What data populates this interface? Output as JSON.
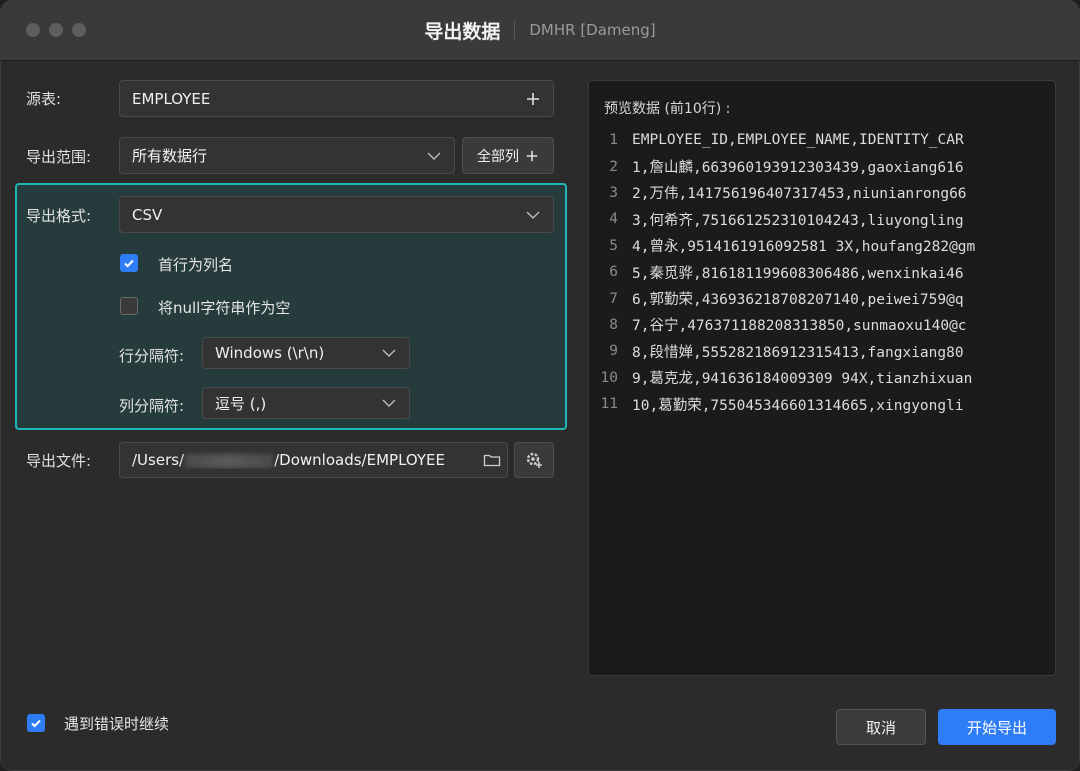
{
  "window": {
    "title": "导出数据",
    "subtitle": "DMHR  [Dameng]"
  },
  "form": {
    "source_label": "源表:",
    "source_value": "EMPLOYEE",
    "range_label": "导出范围:",
    "range_value": "所有数据行",
    "columns_button": "全部列",
    "format_label": "导出格式:",
    "format_value": "CSV",
    "header_row_label": "首行为列名",
    "header_row_checked": true,
    "null_empty_label": "将null字符串作为空",
    "null_empty_checked": false,
    "row_sep_label": "行分隔符:",
    "row_sep_value": "Windows (\\r\\n)",
    "col_sep_label": "列分隔符:",
    "col_sep_value": "逗号 (,)",
    "file_label": "导出文件:",
    "file_prefix": "/Users/",
    "file_suffix": "/Downloads/EMPLOYEE"
  },
  "preview": {
    "title": "预览数据 (前10行) :",
    "lines": [
      {
        "n": "1",
        "text": "EMPLOYEE_ID,EMPLOYEE_NAME,IDENTITY_CAR"
      },
      {
        "n": "2",
        "text": "1,詹山麟,663960193912303439,gaoxiang616"
      },
      {
        "n": "3",
        "text": "2,万伟,141756196407317453,niunianrong66"
      },
      {
        "n": "4",
        "text": "3,何希齐,751661252310104243,liuyongling"
      },
      {
        "n": "5",
        "text": "4,曾永,9514161916092581 3X,houfang282@gm"
      },
      {
        "n": "6",
        "text": "5,秦觅骅,816181199608306486,wenxinkai46"
      },
      {
        "n": "7",
        "text": "6,郭勤荣,436936218708207140,peiwei759@q"
      },
      {
        "n": "8",
        "text": "7,谷宁,476371188208313850,sunmaoxu140@c"
      },
      {
        "n": "9",
        "text": "8,段惜婵,555282186912315413,fangxiang80"
      },
      {
        "n": "10",
        "text": "9,葛克龙,941636184009309 94X,tianzhixuan"
      },
      {
        "n": "11",
        "text": "10,葛勤荣,755045346601314665,xingyongli"
      }
    ]
  },
  "footer": {
    "continue_on_error_label": "遇到错误时继续",
    "continue_on_error_checked": true,
    "cancel_label": "取消",
    "start_label": "开始导出"
  },
  "colors": {
    "accent": "#2f7df6",
    "group_border": "#1fb6b6"
  },
  "icons": [
    "plus-icon",
    "chevron-down-icon",
    "folder-icon",
    "gear-plus-icon",
    "check-icon"
  ]
}
